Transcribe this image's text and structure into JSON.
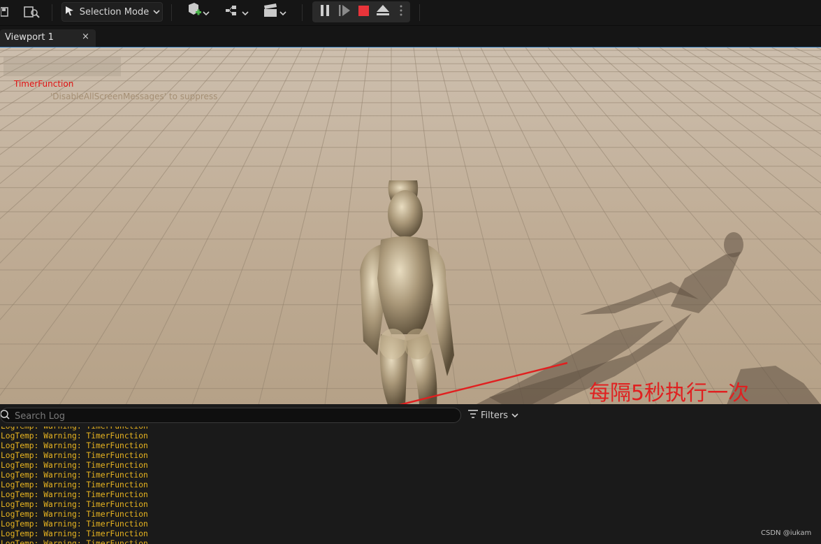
{
  "toolbar": {
    "selection_mode_label": "Selection Mode",
    "icons": [
      "save-icon",
      "browse-icon",
      "selection-mode-icon",
      "add-actor-icon",
      "blueprint-icon",
      "cinematics-icon",
      "pause-icon",
      "frame-skip-icon",
      "stop-icon",
      "eject-icon",
      "more-options-icon"
    ],
    "stop_color": "#e8343a"
  },
  "tabs": [
    {
      "label": "Viewport 1",
      "close": "×"
    }
  ],
  "viewport": {
    "onscreen_message": "TimerFunction",
    "onscreen_hint": "'DisableAllScreenMessages' to suppress",
    "message_color": "#e01010"
  },
  "annotation": {
    "text": "每隔5秒执行一次",
    "color": "#e02020"
  },
  "output_log": {
    "search_placeholder": "Search Log",
    "filters_label": "Filters",
    "lines": [
      "LogTemp: Warning: TimerFunction",
      "LogTemp: Warning: TimerFunction",
      "LogTemp: Warning: TimerFunction",
      "LogTemp: Warning: TimerFunction",
      "LogTemp: Warning: TimerFunction",
      "LogTemp: Warning: TimerFunction",
      "LogTemp: Warning: TimerFunction",
      "LogTemp: Warning: TimerFunction",
      "LogTemp: Warning: TimerFunction",
      "LogTemp: Warning: TimerFunction",
      "LogTemp: Warning: TimerFunction",
      "LogTemp: Warning: TimerFunction",
      "LogTemp: Warning: TimerFunction",
      "LogTemp: Warning: TimerFunction"
    ],
    "line_color": "#e8b420"
  },
  "watermark": "CSDN @iukam"
}
